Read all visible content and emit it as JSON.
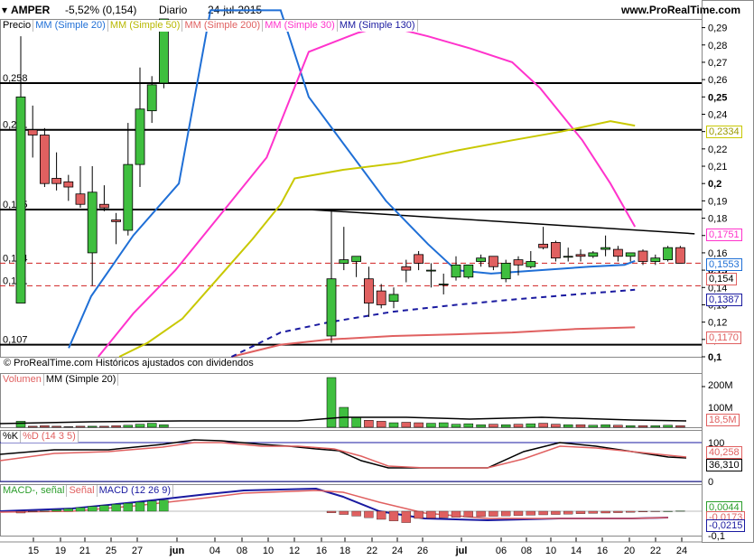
{
  "header": {
    "symbol": "AMPER",
    "change": "-5,52% (0,154)",
    "period": "Diario",
    "date": "24-jul-2015",
    "site": "www.ProRealTime.com"
  },
  "price_panel": {
    "legend": [
      "Precio",
      "MM (Simple 20)",
      "MM (Simple 50)",
      "MM (Simple 200)",
      "MM (Simple 30)",
      "MM (Simple 130)"
    ],
    "legend_colors": [
      "#000000",
      "#1f6fd6",
      "#c8c800",
      "#e06060",
      "#ff33cc",
      "#1a1aa0"
    ],
    "footer": "© ProRealTime.com  Históricos ajustados con dividendos",
    "y_ticks": [
      "0,29",
      "0,28",
      "0,27",
      "0,26",
      "0,25",
      "0,24",
      "0,23",
      "0,22",
      "0,21",
      "0,2",
      "0,19",
      "0,18",
      "0,17",
      "0,16",
      "0,15",
      "0,14",
      "0,13",
      "0,12",
      "0,11",
      "0,1"
    ],
    "level_labels": [
      "0,258",
      "0,231",
      "0,185",
      "0,154",
      "0,141",
      "0,107"
    ],
    "tags": [
      "0,2334",
      "0,1751",
      "0,1553",
      "0,154",
      "0,1387",
      "0,1170"
    ]
  },
  "volume_panel": {
    "legend": [
      "Volumen",
      "MM (Simple 20)"
    ],
    "y_ticks": [
      "200M",
      "100M"
    ],
    "tags": [
      "18,5M"
    ]
  },
  "stoch_panel": {
    "legend": [
      "%K",
      "%D (14 3 5)"
    ],
    "y_ticks": [
      "100",
      "0"
    ],
    "tags": [
      "40,258",
      "36,310"
    ]
  },
  "macd_panel": {
    "legend": [
      "MACD-, señal",
      "Señal",
      "MACD (12 26 9)"
    ],
    "y_ticks": [
      "-0,1"
    ],
    "tags": [
      "0,0044",
      "-0,0173",
      "-0,0215"
    ]
  },
  "x_axis": {
    "labels": [
      "15",
      "19",
      "21",
      "25",
      "27",
      "jun",
      "04",
      "08",
      "10",
      "12",
      "16",
      "18",
      "22",
      "24",
      "26",
      "jul",
      "06",
      "08",
      "10",
      "14",
      "16",
      "20",
      "22",
      "24"
    ]
  },
  "chart_data": {
    "type": "candlestick",
    "title": "AMPER",
    "ylim": [
      0.1,
      0.295
    ],
    "horizontal_levels": [
      0.258,
      0.231,
      0.185,
      0.107
    ],
    "dashed_levels": [
      0.154,
      0.141
    ],
    "candles": [
      {
        "o": 0.131,
        "h": 0.285,
        "l": 0.131,
        "c": 0.25
      },
      {
        "o": 0.231,
        "h": 0.245,
        "l": 0.215,
        "c": 0.228
      },
      {
        "o": 0.228,
        "h": 0.232,
        "l": 0.198,
        "c": 0.2
      },
      {
        "o": 0.203,
        "h": 0.218,
        "l": 0.196,
        "c": 0.2
      },
      {
        "o": 0.201,
        "h": 0.205,
        "l": 0.19,
        "c": 0.198
      },
      {
        "o": 0.194,
        "h": 0.21,
        "l": 0.186,
        "c": 0.188
      },
      {
        "o": 0.16,
        "h": 0.21,
        "l": 0.141,
        "c": 0.195
      },
      {
        "o": 0.188,
        "h": 0.199,
        "l": 0.184,
        "c": 0.186
      },
      {
        "o": 0.179,
        "h": 0.183,
        "l": 0.165,
        "c": 0.178
      },
      {
        "o": 0.173,
        "h": 0.235,
        "l": 0.17,
        "c": 0.211
      },
      {
        "o": 0.211,
        "h": 0.267,
        "l": 0.198,
        "c": 0.243
      },
      {
        "o": 0.242,
        "h": 0.262,
        "l": 0.235,
        "c": 0.257
      },
      {
        "o": 0.258,
        "h": 0.295,
        "l": 0.255,
        "c": 0.295
      },
      {
        "o": 0.112,
        "h": 0.185,
        "l": 0.108,
        "c": 0.145
      },
      {
        "o": 0.154,
        "h": 0.175,
        "l": 0.15,
        "c": 0.156
      },
      {
        "o": 0.155,
        "h": 0.158,
        "l": 0.146,
        "c": 0.158
      },
      {
        "o": 0.145,
        "h": 0.152,
        "l": 0.123,
        "c": 0.131
      },
      {
        "o": 0.138,
        "h": 0.142,
        "l": 0.128,
        "c": 0.13
      },
      {
        "o": 0.132,
        "h": 0.14,
        "l": 0.128,
        "c": 0.136
      },
      {
        "o": 0.152,
        "h": 0.156,
        "l": 0.143,
        "c": 0.15
      },
      {
        "o": 0.159,
        "h": 0.161,
        "l": 0.15,
        "c": 0.154
      },
      {
        "o": 0.15,
        "h": 0.154,
        "l": 0.14,
        "c": 0.15
      },
      {
        "o": 0.142,
        "h": 0.148,
        "l": 0.136,
        "c": 0.142
      },
      {
        "o": 0.146,
        "h": 0.158,
        "l": 0.144,
        "c": 0.153
      },
      {
        "o": 0.146,
        "h": 0.153,
        "l": 0.145,
        "c": 0.153
      },
      {
        "o": 0.155,
        "h": 0.159,
        "l": 0.152,
        "c": 0.157
      },
      {
        "o": 0.158,
        "h": 0.158,
        "l": 0.15,
        "c": 0.152
      },
      {
        "o": 0.145,
        "h": 0.156,
        "l": 0.143,
        "c": 0.154
      },
      {
        "o": 0.156,
        "h": 0.158,
        "l": 0.147,
        "c": 0.153
      },
      {
        "o": 0.152,
        "h": 0.161,
        "l": 0.151,
        "c": 0.155
      },
      {
        "o": 0.165,
        "h": 0.175,
        "l": 0.162,
        "c": 0.163
      },
      {
        "o": 0.166,
        "h": 0.167,
        "l": 0.155,
        "c": 0.157
      },
      {
        "o": 0.158,
        "h": 0.163,
        "l": 0.155,
        "c": 0.158
      },
      {
        "o": 0.159,
        "h": 0.162,
        "l": 0.155,
        "c": 0.158
      },
      {
        "o": 0.158,
        "h": 0.161,
        "l": 0.157,
        "c": 0.16
      },
      {
        "o": 0.162,
        "h": 0.17,
        "l": 0.158,
        "c": 0.163
      },
      {
        "o": 0.162,
        "h": 0.164,
        "l": 0.155,
        "c": 0.158
      },
      {
        "o": 0.158,
        "h": 0.16,
        "l": 0.155,
        "c": 0.16
      },
      {
        "o": 0.161,
        "h": 0.162,
        "l": 0.153,
        "c": 0.155
      },
      {
        "o": 0.155,
        "h": 0.159,
        "l": 0.153,
        "c": 0.157
      },
      {
        "o": 0.156,
        "h": 0.164,
        "l": 0.155,
        "c": 0.163
      },
      {
        "o": 0.163,
        "h": 0.164,
        "l": 0.154,
        "c": 0.154
      }
    ],
    "series": [
      {
        "name": "MM (Simple 20)",
        "color": "#1f6fd6",
        "values": [
          [
            0.098,
            0.105
          ],
          [
            0.13,
            0.135
          ],
          [
            0.19,
            0.17
          ],
          [
            0.255,
            0.2
          ],
          [
            0.3,
            0.3
          ],
          [
            0.4,
            0.3
          ],
          [
            0.44,
            0.25
          ],
          [
            0.55,
            0.19
          ],
          [
            0.61,
            0.165
          ],
          [
            0.65,
            0.15
          ],
          [
            0.7,
            0.148
          ],
          [
            0.77,
            0.15
          ],
          [
            0.84,
            0.152
          ],
          [
            0.89,
            0.153
          ],
          [
            0.905,
            0.1553
          ]
        ]
      },
      {
        "name": "MM (Simple 30)",
        "color": "#ff33cc",
        "values": [
          [
            0.14,
            0.1
          ],
          [
            0.19,
            0.125
          ],
          [
            0.25,
            0.15
          ],
          [
            0.31,
            0.18
          ],
          [
            0.38,
            0.215
          ],
          [
            0.44,
            0.276
          ],
          [
            0.51,
            0.287
          ],
          [
            0.55,
            0.291
          ],
          [
            0.61,
            0.285
          ],
          [
            0.67,
            0.278
          ],
          [
            0.73,
            0.27
          ],
          [
            0.77,
            0.255
          ],
          [
            0.83,
            0.225
          ],
          [
            0.87,
            0.2
          ],
          [
            0.905,
            0.1751
          ]
        ]
      },
      {
        "name": "MM (Simple 50)",
        "color": "#c8c800",
        "values": [
          [
            0.17,
            0.1
          ],
          [
            0.21,
            0.108
          ],
          [
            0.26,
            0.122
          ],
          [
            0.31,
            0.145
          ],
          [
            0.36,
            0.168
          ],
          [
            0.4,
            0.188
          ],
          [
            0.42,
            0.203
          ],
          [
            0.49,
            0.208
          ],
          [
            0.57,
            0.212
          ],
          [
            0.65,
            0.219
          ],
          [
            0.73,
            0.225
          ],
          [
            0.8,
            0.23
          ],
          [
            0.87,
            0.236
          ],
          [
            0.905,
            0.2334
          ]
        ]
      },
      {
        "name": "MM (Simple 200)",
        "color": "#e06060",
        "values": [
          [
            0.33,
            0.1
          ],
          [
            0.4,
            0.107
          ],
          [
            0.47,
            0.11
          ],
          [
            0.56,
            0.112
          ],
          [
            0.65,
            0.113
          ],
          [
            0.73,
            0.114
          ],
          [
            0.82,
            0.116
          ],
          [
            0.905,
            0.117
          ]
        ]
      },
      {
        "name": "MM (Simple 130)",
        "color": "#1a1aa0",
        "values": [
          [
            0.33,
            0.1
          ],
          [
            0.4,
            0.114
          ],
          [
            0.47,
            0.12
          ],
          [
            0.56,
            0.126
          ],
          [
            0.65,
            0.13
          ],
          [
            0.73,
            0.133
          ],
          [
            0.82,
            0.136
          ],
          [
            0.905,
            0.1387
          ]
        ]
      }
    ],
    "trendline": {
      "x": [
        0.44,
        0.99
      ],
      "y": [
        0.185,
        0.171
      ]
    }
  }
}
